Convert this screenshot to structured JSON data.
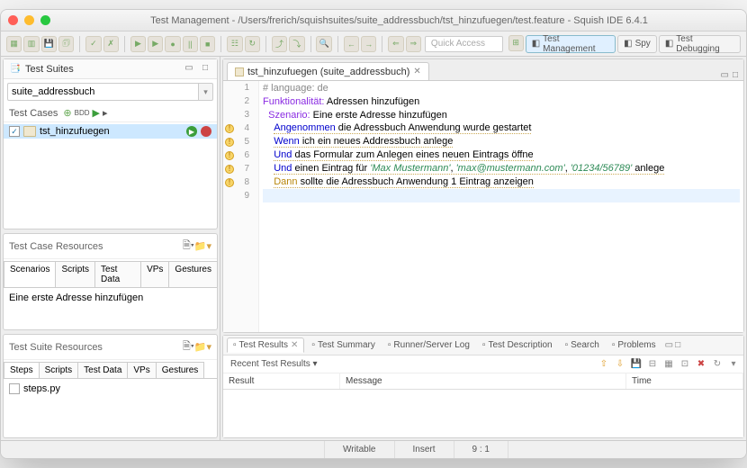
{
  "window": {
    "title": "Test Management - /Users/frerich/squishsuites/suite_addressbuch/tst_hinzufuegen/test.feature - Squish IDE 6.4.1"
  },
  "toolbar": {
    "quick_access": "Quick Access",
    "perspectives": [
      {
        "label": "Test Management",
        "active": true
      },
      {
        "label": "Spy",
        "active": false
      },
      {
        "label": "Test Debugging",
        "active": false
      }
    ]
  },
  "test_suites": {
    "title": "Test Suites",
    "selected_suite": "suite_addressbuch",
    "test_cases": {
      "title": "Test Cases",
      "items": [
        {
          "name": "tst_hinzufuegen",
          "checked": true
        }
      ]
    }
  },
  "test_case_resources": {
    "title": "Test Case Resources",
    "tabs": [
      "Scenarios",
      "Scripts",
      "Test Data",
      "VPs",
      "Gestures"
    ],
    "items": [
      "Eine erste Adresse hinzufügen"
    ]
  },
  "test_suite_resources": {
    "title": "Test Suite Resources",
    "tabs": [
      "Steps",
      "Scripts",
      "Test Data",
      "VPs",
      "Gestures"
    ],
    "items": [
      "steps.py"
    ]
  },
  "editor": {
    "tab_label": "tst_hinzufuegen (suite_addressbuch)",
    "lines": [
      {
        "n": 1,
        "content": {
          "pre": "# language: de",
          "cls": "c-comment"
        }
      },
      {
        "n": 2,
        "content": {
          "kw": "Funktionalität:",
          "rest": " Adressen hinzufügen",
          "kwcls": "c-kw1"
        }
      },
      {
        "n": 3,
        "indent": "  ",
        "content": {
          "kw": "Szenario:",
          "rest": " Eine erste Adresse hinzufügen",
          "kwcls": "c-kw1"
        }
      },
      {
        "n": 4,
        "warn": true,
        "indent": "    ",
        "content": {
          "kw": "Angenommen",
          "rest": " die Adressbuch Anwendung wurde gestartet",
          "kwcls": "c-kw2",
          "dotted": true
        }
      },
      {
        "n": 5,
        "warn": true,
        "indent": "    ",
        "content": {
          "kw": "Wenn",
          "rest": " ich ein neues Addressbuch anlege",
          "kwcls": "c-kw2",
          "dotted": true
        }
      },
      {
        "n": 6,
        "warn": true,
        "indent": "    ",
        "content": {
          "kw": "Und",
          "rest": " das Formular zum Anlegen eines neuen Eintrags öffne",
          "kwcls": "c-kw2",
          "dotted": true
        }
      },
      {
        "n": 7,
        "warn": true,
        "indent": "    ",
        "content": {
          "kw": "Und",
          "pre_str": " einen Eintrag für ",
          "strings": [
            "'Max Mustermann'",
            "'max@mustermann.com'",
            "'01234/56789'"
          ],
          "tail": " anlege",
          "kwcls": "c-kw2",
          "dotted": true
        }
      },
      {
        "n": 8,
        "warn": true,
        "indent": "    ",
        "content": {
          "kw": "Dann",
          "rest": " sollte die Adressbuch Anwendung 1 Eintrag anzeigen",
          "kwcls": "c-kw3",
          "dotted": true
        }
      },
      {
        "n": 9,
        "cursor": true
      }
    ]
  },
  "bottom": {
    "tabs": [
      {
        "label": "Test Results",
        "active": true,
        "closable": true
      },
      {
        "label": "Test Summary"
      },
      {
        "label": "Runner/Server Log"
      },
      {
        "label": "Test Description"
      },
      {
        "label": "Search"
      },
      {
        "label": "Problems"
      }
    ],
    "recent_label": "Recent Test Results ▾",
    "columns": [
      "Result",
      "Message",
      "Time"
    ]
  },
  "status": {
    "writable": "Writable",
    "insert": "Insert",
    "pos": "9 : 1"
  }
}
